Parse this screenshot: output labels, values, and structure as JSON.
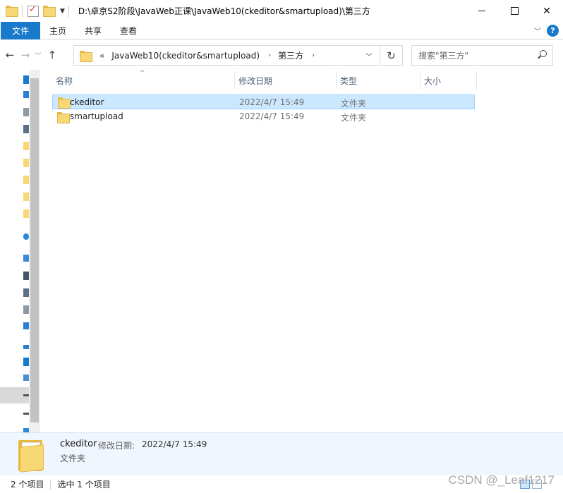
{
  "titlebar": {
    "path": "D:\\卓京S2阶段\\JavaWeb正课\\JavaWeb10(ckeditor&smartupload)\\第三方",
    "minimize": "",
    "maximize": "",
    "close": "✕"
  },
  "ribbon": {
    "tabs": [
      "文件",
      "主页",
      "共享",
      "查看"
    ],
    "expand": "﹀",
    "help": "?"
  },
  "address": {
    "back": "←",
    "forward": "→",
    "recent": "﹀",
    "up": "↑",
    "overflow": "«",
    "crumbs": [
      "JavaWeb10(ckeditor&smartupload)",
      "第三方"
    ],
    "crumb_sep": "›",
    "dropdown": "﹀",
    "refresh": "↻"
  },
  "search": {
    "placeholder": "搜索\"第三方\""
  },
  "columns": {
    "name": "名称",
    "modified": "修改日期",
    "type": "类型",
    "size": "大小",
    "sort_indicator": "^"
  },
  "files": [
    {
      "name": "ckeditor",
      "modified": "2022/4/7 15:49",
      "type": "文件夹",
      "size": "",
      "selected": true
    },
    {
      "name": "smartupload",
      "modified": "2022/4/7 15:49",
      "type": "文件夹",
      "size": "",
      "selected": false
    }
  ],
  "details": {
    "name": "ckeditor",
    "modified_label": "修改日期:",
    "modified_value": "2022/4/7 15:49",
    "type": "文件夹"
  },
  "status": {
    "item_count": "2 个项目",
    "selected_count": "选中 1 个项目"
  },
  "watermark": "CSDN @_Leaf1217",
  "colors": {
    "accent": "#1979ca",
    "selection": "#cce8ff",
    "folder": "#f8d775"
  }
}
